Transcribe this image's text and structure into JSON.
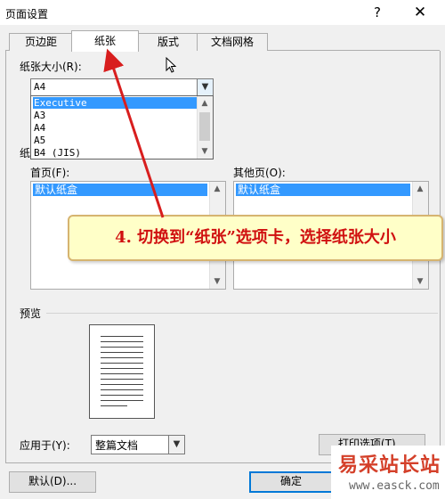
{
  "window": {
    "title": "页面设置",
    "help_label": "?",
    "close_label": "✕"
  },
  "tabs": [
    {
      "label": "页边距",
      "active": false
    },
    {
      "label": "纸张",
      "active": true
    },
    {
      "label": "版式",
      "active": false
    },
    {
      "label": "文档网格",
      "active": false
    }
  ],
  "paper_size": {
    "label": "纸张大小(R):",
    "value": "A4",
    "options": [
      "Executive",
      "A3",
      "A4",
      "A5",
      "B4 (JIS)"
    ],
    "selected": "Executive"
  },
  "paper_source": {
    "label": "纸张来源",
    "first_page_label": "首页(F):",
    "other_pages_label": "其他页(O):",
    "first_page_value": "默认纸盒",
    "other_pages_value": "默认纸盒"
  },
  "preview": {
    "label": "预览"
  },
  "apply_to": {
    "label": "应用于(Y):",
    "value": "整篇文档"
  },
  "buttons": {
    "print_options": "打印选项(T)...",
    "default": "默认(D)...",
    "ok": "确定"
  },
  "callout": {
    "text": "4. 切换到“纸张”选项卡，选择纸张大小"
  },
  "watermark": {
    "brand": "易采站长站",
    "url": "www.easck.com"
  },
  "colors": {
    "selection": "#3399ff",
    "callout_text": "#d01010",
    "arrow": "#d81e1e"
  }
}
